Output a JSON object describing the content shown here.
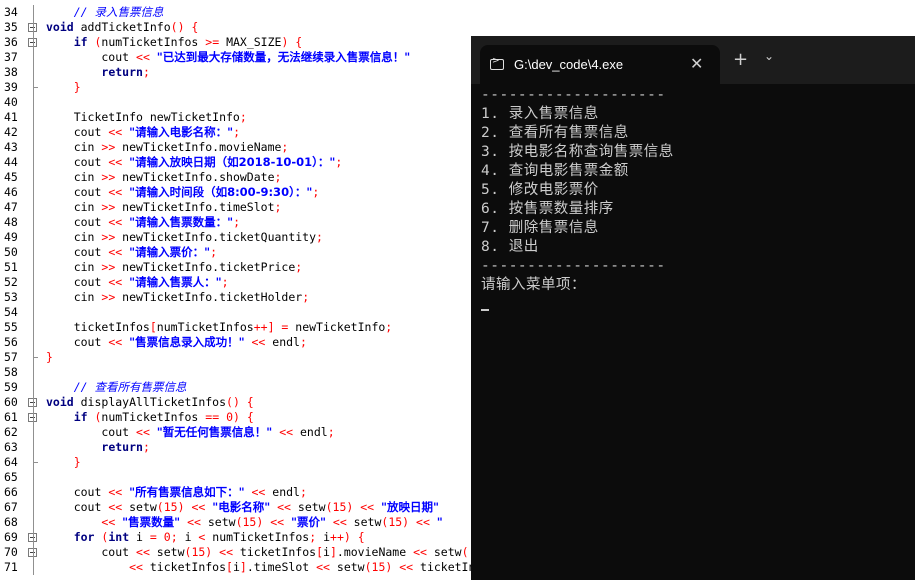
{
  "editor": {
    "lines": [
      {
        "n": "34",
        "segs": [
          {
            "t": "    // 录入售票信息",
            "c": "cm"
          }
        ]
      },
      {
        "n": "35",
        "segs": [
          {
            "t": "void ",
            "c": "kw"
          },
          {
            "t": "addTicketInfo"
          },
          {
            "t": "() {",
            "c": "op"
          }
        ]
      },
      {
        "n": "36",
        "segs": [
          {
            "t": "    "
          },
          {
            "t": "if ",
            "c": "kw"
          },
          {
            "t": "(",
            "c": "op"
          },
          {
            "t": "numTicketInfos "
          },
          {
            "t": ">= ",
            "c": "op"
          },
          {
            "t": "MAX_SIZE"
          },
          {
            "t": ") {",
            "c": "op"
          }
        ]
      },
      {
        "n": "37",
        "segs": [
          {
            "t": "        cout "
          },
          {
            "t": "<< ",
            "c": "op"
          },
          {
            "t": "\"已达到最大存储数量，无法继续录入售票信息！\"",
            "c": "str"
          }
        ]
      },
      {
        "n": "38",
        "segs": [
          {
            "t": "        "
          },
          {
            "t": "return",
            "c": "kw"
          },
          {
            "t": ";",
            "c": "op"
          }
        ]
      },
      {
        "n": "39",
        "segs": [
          {
            "t": "    "
          },
          {
            "t": "}",
            "c": "op"
          }
        ]
      },
      {
        "n": "40",
        "segs": [
          {
            "t": ""
          }
        ]
      },
      {
        "n": "41",
        "segs": [
          {
            "t": "    TicketInfo newTicketInfo"
          },
          {
            "t": ";",
            "c": "op"
          }
        ]
      },
      {
        "n": "42",
        "segs": [
          {
            "t": "    cout "
          },
          {
            "t": "<< ",
            "c": "op"
          },
          {
            "t": "\"请输入电影名称：\"",
            "c": "str"
          },
          {
            "t": ";",
            "c": "op"
          }
        ]
      },
      {
        "n": "43",
        "segs": [
          {
            "t": "    cin "
          },
          {
            "t": ">> ",
            "c": "op"
          },
          {
            "t": "newTicketInfo.movieName"
          },
          {
            "t": ";",
            "c": "op"
          }
        ]
      },
      {
        "n": "44",
        "segs": [
          {
            "t": "    cout "
          },
          {
            "t": "<< ",
            "c": "op"
          },
          {
            "t": "\"请输入放映日期（如2018-10-01）：\"",
            "c": "str"
          },
          {
            "t": ";",
            "c": "op"
          }
        ]
      },
      {
        "n": "45",
        "segs": [
          {
            "t": "    cin "
          },
          {
            "t": ">> ",
            "c": "op"
          },
          {
            "t": "newTicketInfo.showDate"
          },
          {
            "t": ";",
            "c": "op"
          }
        ]
      },
      {
        "n": "46",
        "segs": [
          {
            "t": "    cout "
          },
          {
            "t": "<< ",
            "c": "op"
          },
          {
            "t": "\"请输入时间段（如8:00-9:30）：\"",
            "c": "str"
          },
          {
            "t": ";",
            "c": "op"
          }
        ]
      },
      {
        "n": "47",
        "segs": [
          {
            "t": "    cin "
          },
          {
            "t": ">> ",
            "c": "op"
          },
          {
            "t": "newTicketInfo.timeSlot"
          },
          {
            "t": ";",
            "c": "op"
          }
        ]
      },
      {
        "n": "48",
        "segs": [
          {
            "t": "    cout "
          },
          {
            "t": "<< ",
            "c": "op"
          },
          {
            "t": "\"请输入售票数量：\"",
            "c": "str"
          },
          {
            "t": ";",
            "c": "op"
          }
        ]
      },
      {
        "n": "49",
        "segs": [
          {
            "t": "    cin "
          },
          {
            "t": ">> ",
            "c": "op"
          },
          {
            "t": "newTicketInfo.ticketQuantity"
          },
          {
            "t": ";",
            "c": "op"
          }
        ]
      },
      {
        "n": "50",
        "segs": [
          {
            "t": "    cout "
          },
          {
            "t": "<< ",
            "c": "op"
          },
          {
            "t": "\"请输入票价：\"",
            "c": "str"
          },
          {
            "t": ";",
            "c": "op"
          }
        ]
      },
      {
        "n": "51",
        "segs": [
          {
            "t": "    cin "
          },
          {
            "t": ">> ",
            "c": "op"
          },
          {
            "t": "newTicketInfo.ticketPrice"
          },
          {
            "t": ";",
            "c": "op"
          }
        ]
      },
      {
        "n": "52",
        "segs": [
          {
            "t": "    cout "
          },
          {
            "t": "<< ",
            "c": "op"
          },
          {
            "t": "\"请输入售票人：\"",
            "c": "str"
          },
          {
            "t": ";",
            "c": "op"
          }
        ]
      },
      {
        "n": "53",
        "segs": [
          {
            "t": "    cin "
          },
          {
            "t": ">> ",
            "c": "op"
          },
          {
            "t": "newTicketInfo.ticketHolder"
          },
          {
            "t": ";",
            "c": "op"
          }
        ]
      },
      {
        "n": "54",
        "segs": [
          {
            "t": ""
          }
        ]
      },
      {
        "n": "55",
        "segs": [
          {
            "t": "    ticketInfos"
          },
          {
            "t": "[",
            "c": "op"
          },
          {
            "t": "numTicketInfos"
          },
          {
            "t": "++] = ",
            "c": "op"
          },
          {
            "t": "newTicketInfo"
          },
          {
            "t": ";",
            "c": "op"
          }
        ]
      },
      {
        "n": "56",
        "segs": [
          {
            "t": "    cout "
          },
          {
            "t": "<< ",
            "c": "op"
          },
          {
            "t": "\"售票信息录入成功！\"",
            "c": "str"
          },
          {
            "t": " << ",
            "c": "op"
          },
          {
            "t": "endl"
          },
          {
            "t": ";",
            "c": "op"
          }
        ]
      },
      {
        "n": "57",
        "segs": [
          {
            "t": "}",
            "c": "op"
          }
        ]
      },
      {
        "n": "58",
        "segs": [
          {
            "t": ""
          }
        ]
      },
      {
        "n": "59",
        "segs": [
          {
            "t": "    // 查看所有售票信息",
            "c": "cm"
          }
        ]
      },
      {
        "n": "60",
        "segs": [
          {
            "t": "void ",
            "c": "kw"
          },
          {
            "t": "displayAllTicketInfos"
          },
          {
            "t": "() {",
            "c": "op"
          }
        ]
      },
      {
        "n": "61",
        "segs": [
          {
            "t": "    "
          },
          {
            "t": "if ",
            "c": "kw"
          },
          {
            "t": "(",
            "c": "op"
          },
          {
            "t": "numTicketInfos "
          },
          {
            "t": "== ",
            "c": "op"
          },
          {
            "t": "0",
            "c": "num"
          },
          {
            "t": ") {",
            "c": "op"
          }
        ]
      },
      {
        "n": "62",
        "segs": [
          {
            "t": "        cout "
          },
          {
            "t": "<< ",
            "c": "op"
          },
          {
            "t": "\"暂无任何售票信息！\"",
            "c": "str"
          },
          {
            "t": " << ",
            "c": "op"
          },
          {
            "t": "endl"
          },
          {
            "t": ";",
            "c": "op"
          }
        ]
      },
      {
        "n": "63",
        "segs": [
          {
            "t": "        "
          },
          {
            "t": "return",
            "c": "kw"
          },
          {
            "t": ";",
            "c": "op"
          }
        ]
      },
      {
        "n": "64",
        "segs": [
          {
            "t": "    "
          },
          {
            "t": "}",
            "c": "op"
          }
        ]
      },
      {
        "n": "65",
        "segs": [
          {
            "t": ""
          }
        ]
      },
      {
        "n": "66",
        "segs": [
          {
            "t": "    cout "
          },
          {
            "t": "<< ",
            "c": "op"
          },
          {
            "t": "\"所有售票信息如下：\"",
            "c": "str"
          },
          {
            "t": " << ",
            "c": "op"
          },
          {
            "t": "endl"
          },
          {
            "t": ";",
            "c": "op"
          }
        ]
      },
      {
        "n": "67",
        "segs": [
          {
            "t": "    cout "
          },
          {
            "t": "<< ",
            "c": "op"
          },
          {
            "t": "setw"
          },
          {
            "t": "(",
            "c": "op"
          },
          {
            "t": "15",
            "c": "num"
          },
          {
            "t": ") << ",
            "c": "op"
          },
          {
            "t": "\"电影名称\"",
            "c": "str"
          },
          {
            "t": " << ",
            "c": "op"
          },
          {
            "t": "setw"
          },
          {
            "t": "(",
            "c": "op"
          },
          {
            "t": "15",
            "c": "num"
          },
          {
            "t": ") << ",
            "c": "op"
          },
          {
            "t": "\"放映日期\"",
            "c": "str"
          }
        ]
      },
      {
        "n": "68",
        "segs": [
          {
            "t": "        "
          },
          {
            "t": "<< ",
            "c": "op"
          },
          {
            "t": "\"售票数量\"",
            "c": "str"
          },
          {
            "t": " << ",
            "c": "op"
          },
          {
            "t": "setw"
          },
          {
            "t": "(",
            "c": "op"
          },
          {
            "t": "15",
            "c": "num"
          },
          {
            "t": ") << ",
            "c": "op"
          },
          {
            "t": "\"票价\"",
            "c": "str"
          },
          {
            "t": " << ",
            "c": "op"
          },
          {
            "t": "setw"
          },
          {
            "t": "(",
            "c": "op"
          },
          {
            "t": "15",
            "c": "num"
          },
          {
            "t": ") << ",
            "c": "op"
          },
          {
            "t": "\"",
            "c": "str"
          }
        ]
      },
      {
        "n": "69",
        "segs": [
          {
            "t": "    "
          },
          {
            "t": "for ",
            "c": "kw"
          },
          {
            "t": "(",
            "c": "op"
          },
          {
            "t": "int ",
            "c": "kw"
          },
          {
            "t": "i "
          },
          {
            "t": "= ",
            "c": "op"
          },
          {
            "t": "0",
            "c": "num"
          },
          {
            "t": "; ",
            "c": "op"
          },
          {
            "t": "i "
          },
          {
            "t": "< ",
            "c": "op"
          },
          {
            "t": "numTicketInfos"
          },
          {
            "t": "; ",
            "c": "op"
          },
          {
            "t": "i"
          },
          {
            "t": "++) {",
            "c": "op"
          }
        ]
      },
      {
        "n": "70",
        "segs": [
          {
            "t": "        cout "
          },
          {
            "t": "<< ",
            "c": "op"
          },
          {
            "t": "setw"
          },
          {
            "t": "(",
            "c": "op"
          },
          {
            "t": "15",
            "c": "num"
          },
          {
            "t": ") << ",
            "c": "op"
          },
          {
            "t": "ticketInfos"
          },
          {
            "t": "[",
            "c": "op"
          },
          {
            "t": "i"
          },
          {
            "t": "]",
            "c": "op"
          },
          {
            "t": ".movieName "
          },
          {
            "t": "<< ",
            "c": "op"
          },
          {
            "t": "setw"
          },
          {
            "t": "(",
            "c": "op"
          }
        ]
      },
      {
        "n": "71",
        "segs": [
          {
            "t": "            "
          },
          {
            "t": "<< ",
            "c": "op"
          },
          {
            "t": "ticketInfos"
          },
          {
            "t": "[",
            "c": "op"
          },
          {
            "t": "i"
          },
          {
            "t": "]",
            "c": "op"
          },
          {
            "t": ".timeSlot "
          },
          {
            "t": "<< ",
            "c": "op"
          },
          {
            "t": "setw"
          },
          {
            "t": "(",
            "c": "op"
          },
          {
            "t": "15",
            "c": "num"
          },
          {
            "t": ") << ",
            "c": "op"
          },
          {
            "t": "ticketInfos"
          }
        ]
      }
    ]
  },
  "terminal": {
    "tab_title": "G:\\dev_code\\4.exe",
    "close_glyph": "✕",
    "new_tab_glyph": "+",
    "dropdown_glyph": "⌄",
    "lines": [
      "--------------------",
      "1. 录入售票信息",
      "2. 查看所有售票信息",
      "3. 按电影名称查询售票信息",
      "4. 查询电影售票金额",
      "5. 修改电影票价",
      "6. 按售票数量排序",
      "7. 删除售票信息",
      "8. 退出",
      "--------------------",
      "请输入菜单项："
    ]
  }
}
